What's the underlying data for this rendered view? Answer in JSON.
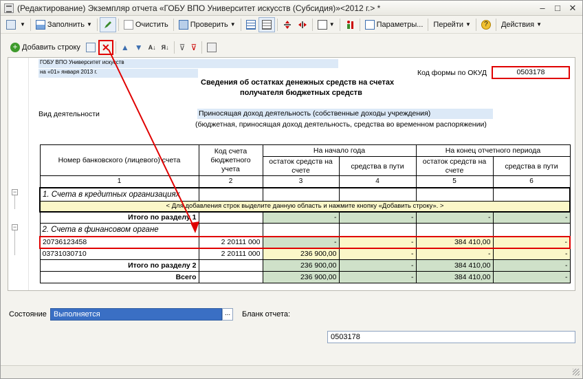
{
  "window": {
    "title": "(Редактирование) Экземпляр отчета «ГОБУ ВПО Университет искусств (Субсидия)»<2012 г.> *"
  },
  "toolbar": {
    "fill": "Заполнить",
    "clear": "Очистить",
    "check": "Проверить",
    "params": "Параметры...",
    "goto": "Перейти",
    "actions": "Действия"
  },
  "toolbar2": {
    "add_row": "Добавить строку"
  },
  "report": {
    "org": "ГОБУ ВПО Университет искусств",
    "date": "на «01» января 2013 г.",
    "okud_label": "Код формы по ОКУД",
    "okud_value": "0503178",
    "title_line1": "Сведения об остатках денежных средств на счетах",
    "title_line2": "получателя бюджетных средств",
    "activity_label": "Вид деятельности",
    "activity_value": "Приносящая доход деятельность (собственные доходы учреждения)",
    "activity_hint": "(бюджетная, приносящая доход деятельность, средства во временном распоряжении)"
  },
  "table": {
    "h_account": "Номер банковского (лицевого) счета",
    "h_code": "Код счета бюджетного учета",
    "h_start": "На начало года",
    "h_end": "На конец отчетного периода",
    "h_balance": "остаток средств на счете",
    "h_transit": "средства в пути",
    "nums": [
      "1",
      "2",
      "3",
      "4",
      "5",
      "6"
    ],
    "section1": "1. Счета в кредитных организациях",
    "hint": "< Для добавления строк выделите данную область и нажмите кнопку «Добавить строку». >",
    "total1": "Итого по разделу 1",
    "section2": "2. Счета в финансовом органе",
    "rows": [
      {
        "account": "20736123458",
        "code": "2 20111 000",
        "c3": "-",
        "c4": "-",
        "c5": "384 410,00",
        "c6": "-"
      },
      {
        "account": "03731030710",
        "code": "2 20111 000",
        "c3": "236 900,00",
        "c4": "-",
        "c5": "-",
        "c6": "-"
      }
    ],
    "total2_label": "Итого по разделу 2",
    "total2": {
      "c3": "236 900,00",
      "c4": "-",
      "c5": "384 410,00",
      "c6": "-"
    },
    "grand_label": "Всего",
    "grand": {
      "c3": "236 900,00",
      "c4": "-",
      "c5": "384 410,00",
      "c6": "-"
    },
    "dash": "-"
  },
  "footer": {
    "state_label": "Состояние",
    "state_value": "Выполняется",
    "blank_label": "Бланк отчета:",
    "blank_value": "0503178"
  },
  "colors": {
    "highlight": "#e00000",
    "total_fill": "#cfe1c9",
    "hint_fill": "#fbf7c8",
    "blue_fill": "#dce9f7"
  }
}
